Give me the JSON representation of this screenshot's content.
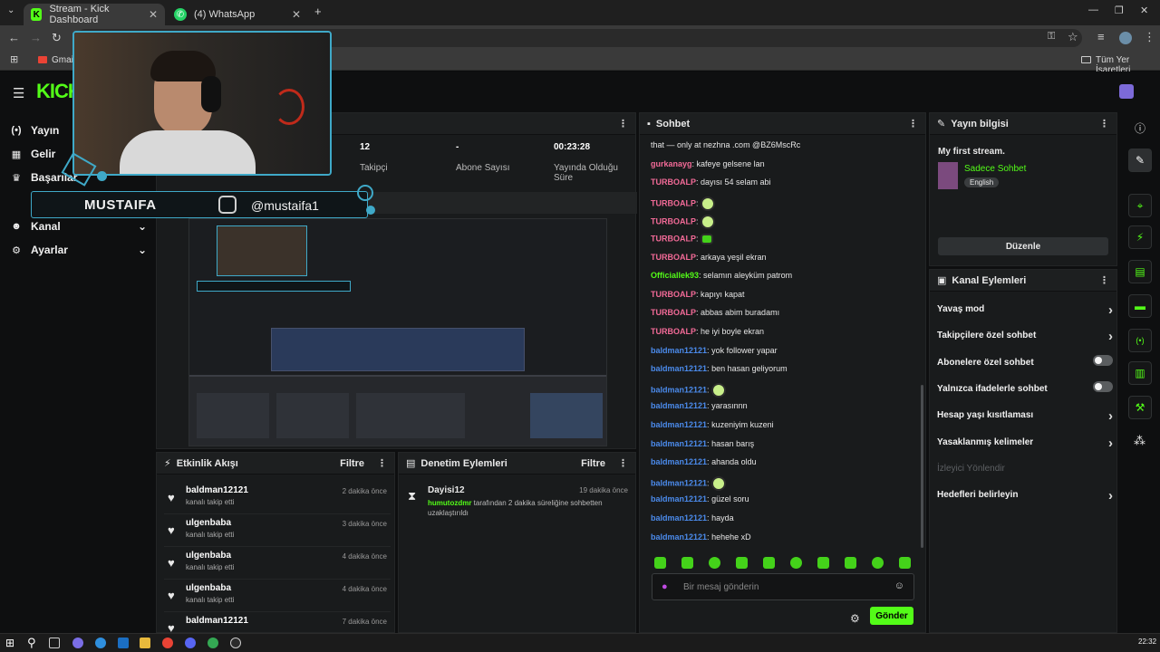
{
  "browser": {
    "tabs": [
      {
        "label": "Stream - Kick Dashboard",
        "active": true
      },
      {
        "label": "(4) WhatsApp",
        "active": false
      }
    ],
    "bookmarks": {
      "first": "Gmail",
      "all": "Tüm Yer İşaretleri"
    }
  },
  "sidebar": {
    "items": [
      {
        "label": "Yayın",
        "icon": "broadcast-icon"
      },
      {
        "label": "Gelir",
        "icon": "bank-icon"
      },
      {
        "label": "Başarılar",
        "icon": "trophy-icon"
      },
      {
        "label": "Kanal",
        "icon": "users-icon"
      },
      {
        "label": "Ayarlar",
        "icon": "gear-icon"
      }
    ]
  },
  "overlay": {
    "name": "MUSTAIFA",
    "handle": "@mustaifa1"
  },
  "stats": [
    {
      "value": "12",
      "label": "Takipçi"
    },
    {
      "value": "-",
      "label": "Abone Sayısı"
    },
    {
      "value": "00:23:28",
      "label": "Yayında Olduğu Süre"
    }
  ],
  "activity": {
    "title": "Etkinlik Akışı",
    "filter": "Filtre",
    "events": [
      {
        "user": "baldman12121",
        "desc": "kanalı takip etti",
        "time": "2 dakika önce"
      },
      {
        "user": "ulgenbaba",
        "desc": "kanalı takip etti",
        "time": "3 dakika önce"
      },
      {
        "user": "ulgenbaba",
        "desc": "kanalı takip etti",
        "time": "4 dakika önce"
      },
      {
        "user": "ulgenbaba",
        "desc": "kanalı takip etti",
        "time": "4 dakika önce"
      },
      {
        "user": "baldman12121",
        "desc": "",
        "time": "7 dakika önce"
      }
    ]
  },
  "moderation": {
    "title": "Denetim Eylemleri",
    "filter": "Filtre",
    "entry": {
      "user": "Dayisi12",
      "time": "19 dakika önce",
      "by": "humutozdmr",
      "text": "tarafından 2 dakika süreliğine sohbetten uzaklaştırıldı"
    }
  },
  "chat": {
    "title": "Sohbet",
    "lines": [
      {
        "user": "",
        "text": "that — only at nezhna .com @BZ6MscRc",
        "color": "none"
      },
      {
        "user": "gurkanayg",
        "text": "kafeye gelsene lan",
        "color": "pink"
      },
      {
        "user": "TURBOALP",
        "text": "dayısı 54 selam abi",
        "color": "pink"
      },
      {
        "user": "TURBOALP",
        "text": "",
        "color": "pink",
        "emote": "round"
      },
      {
        "user": "TURBOALP",
        "text": "",
        "color": "pink",
        "emote": "round"
      },
      {
        "user": "TURBOALP",
        "text": "",
        "color": "pink",
        "emote": "square"
      },
      {
        "user": "TURBOALP",
        "text": "arkaya yeşil ekran",
        "color": "pink"
      },
      {
        "user": "Officiallek93",
        "text": "selamın aleyküm patrom",
        "color": "green"
      },
      {
        "user": "TURBOALP",
        "text": "kapıyı kapat",
        "color": "pink"
      },
      {
        "user": "TURBOALP",
        "text": "abbas abim buradamı",
        "color": "pink"
      },
      {
        "user": "TURBOALP",
        "text": "he iyi boyle ekran",
        "color": "pink"
      },
      {
        "user": "baldman12121",
        "text": "yok follower yapar",
        "color": "blue"
      },
      {
        "user": "baldman12121",
        "text": "ben hasan geliyorum",
        "color": "blue"
      },
      {
        "user": "baldman12121",
        "text": "",
        "color": "blue",
        "emote": "round"
      },
      {
        "user": "baldman12121",
        "text": "yarasınnn",
        "color": "blue"
      },
      {
        "user": "baldman12121",
        "text": "kuzeniyim kuzeni",
        "color": "blue"
      },
      {
        "user": "baldman12121",
        "text": "hasan barış",
        "color": "blue"
      },
      {
        "user": "baldman12121",
        "text": "ahanda oldu",
        "color": "blue"
      },
      {
        "user": "baldman12121",
        "text": "",
        "color": "blue",
        "emote": "round"
      },
      {
        "user": "baldman12121",
        "text": "güzel soru",
        "color": "blue"
      },
      {
        "user": "baldman12121",
        "text": "hayda",
        "color": "blue"
      },
      {
        "user": "baldman12121",
        "text": "hehehe xD",
        "color": "blue"
      }
    ],
    "input_placeholder": "Bir mesaj gönderin",
    "send_label": "Gönder"
  },
  "stream_info": {
    "title": "Yayın bilgisi",
    "stream_title": "My first stream.",
    "category": "Sadece Sohbet",
    "language": "English",
    "edit_label": "Düzenle"
  },
  "channel_actions": {
    "title": "Kanal Eylemleri",
    "items": [
      {
        "label": "Yavaş mod",
        "control": "chevron"
      },
      {
        "label": "Takipçilere özel sohbet",
        "control": "chevron"
      },
      {
        "label": "Abonelere özel sohbet",
        "control": "toggle",
        "on": false
      },
      {
        "label": "Yalnızca ifadelerle sohbet",
        "control": "toggle",
        "on": false
      },
      {
        "label": "Hesap yaşı kısıtlaması",
        "control": "chevron"
      },
      {
        "label": "Yasaklanmış kelimeler",
        "control": "chevron"
      },
      {
        "label": "İzleyici Yönlendir",
        "control": "disabled"
      },
      {
        "label": "Hedefleri belirleyin",
        "control": "chevron"
      }
    ]
  },
  "taskbar": {
    "clock": "22:32"
  },
  "colors": {
    "accent": "#53fc18",
    "pink": "#f26a97",
    "blue": "#4b8bec",
    "overlay": "#3fa9c8"
  }
}
